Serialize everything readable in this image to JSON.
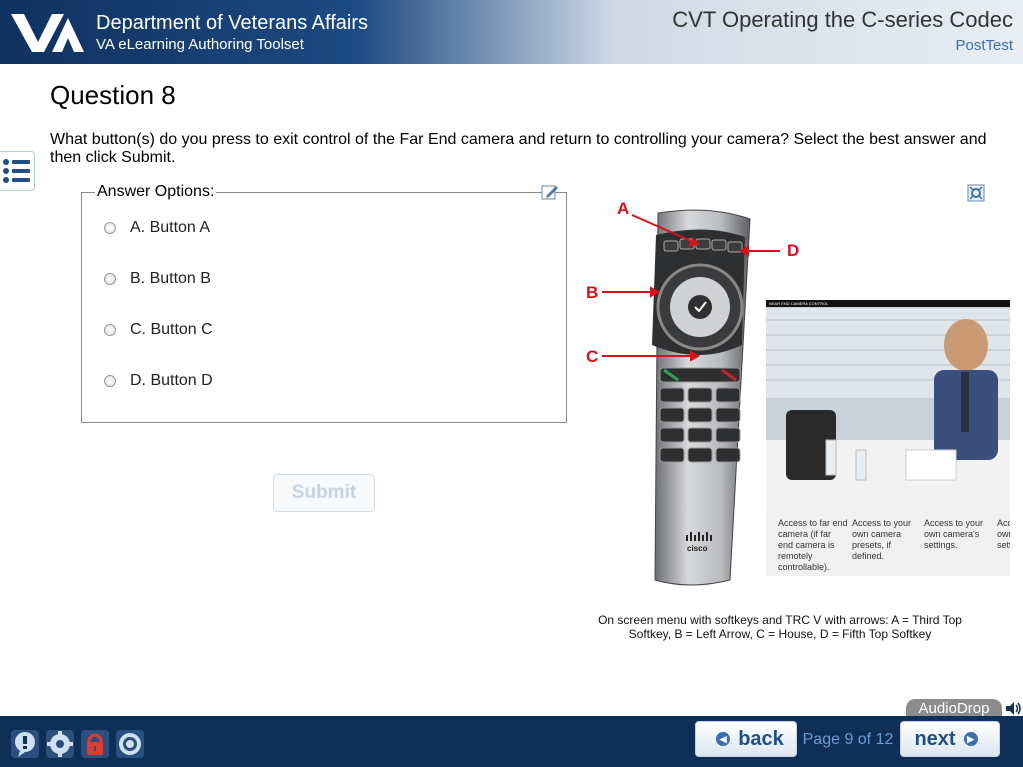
{
  "header": {
    "dept_title": "Department of Veterans Affairs",
    "dept_subtitle": "VA eLearning Authoring Toolset",
    "course_title": "CVT Operating the C-series Codec",
    "section_title": "PostTest"
  },
  "question": {
    "title": "Question 8",
    "text": "What button(s) do you press to exit control of the Far End camera and return to controlling your camera? Select the best answer and then click Submit.",
    "legend": "Answer Options:",
    "options": [
      "A. Button A",
      "B. Button B",
      "C. Button C",
      "D. Button D"
    ],
    "submit_label": "Submit"
  },
  "figure": {
    "annotations": {
      "a": "A",
      "b": "B",
      "c": "C",
      "d": "D"
    },
    "remote_brand": "cisco",
    "screen_header": "NEAR END CAMERA CONTROL",
    "softkeys": [
      "Access to far end camera (if far end camera is remotely controllable).",
      "Access to your own camera presets, if defined.",
      "Access to your own camera's settings.",
      "Access to your own manual settings."
    ],
    "caption": "On screen menu with softkeys and TRC V with arrows: A = Third Top Softkey, B =  Left Arrow, C = House, D = Fifth Top Softkey"
  },
  "audio": {
    "label": "AudioDrop"
  },
  "footer": {
    "back_label": "back",
    "next_label": "next",
    "page_indicator": "Page 9 of 12",
    "icons": [
      "help-icon",
      "settings-icon",
      "lock-icon",
      "target-icon"
    ]
  },
  "colors": {
    "header_dark": "#0f3160",
    "footer": "#0f2f57",
    "accent_blue": "#3a6fb0",
    "annotation_red": "#d8111c"
  }
}
